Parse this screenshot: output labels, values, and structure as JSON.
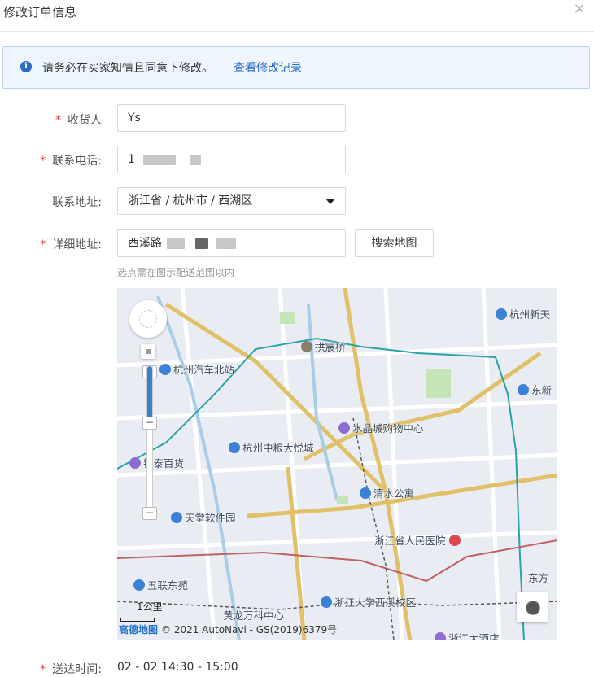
{
  "dialog": {
    "title": "修改订单信息",
    "close_icon": "×"
  },
  "notice": {
    "icon": "i",
    "text": "请务必在买家知情且同意下修改。",
    "link": "查看修改记录"
  },
  "form": {
    "required_mark": "*",
    "receiver": {
      "label": "收货人",
      "value": "Ys",
      "required": true
    },
    "phone": {
      "label": "联系电话:",
      "value_prefix": "1",
      "required": true
    },
    "region": {
      "label": "联系地址:",
      "value": "浙江省 / 杭州市 / 西湖区",
      "required": false
    },
    "detail": {
      "label": "详细地址:",
      "value_prefix": "西溪路",
      "required": true
    },
    "search_map_button": "搜索地图",
    "map_hint": "选点需在图示配送范围以内",
    "delivery_time": {
      "label": "送达时间:",
      "value": "02 - 02 14:30 - 15:00",
      "required": true
    }
  },
  "map": {
    "pois": [
      "杭州新天",
      "杭州汽车北站",
      "拱宸桥",
      "东新",
      "水晶城购物中心",
      "杭州中粮大悦城",
      "银泰百货",
      "清水公寓",
      "天堂软件园",
      "浙江省人民医院",
      "五联东苑",
      "黄龙万科中心",
      "浙江大学西溪校区",
      "东方",
      "浙江大酒店"
    ],
    "scale_label": "1公里",
    "attribution_logo": "高德地图",
    "attribution": "© 2021 AutoNavi - GS(2019)6379号",
    "zoom_in": "+",
    "zoom_out": "−"
  }
}
